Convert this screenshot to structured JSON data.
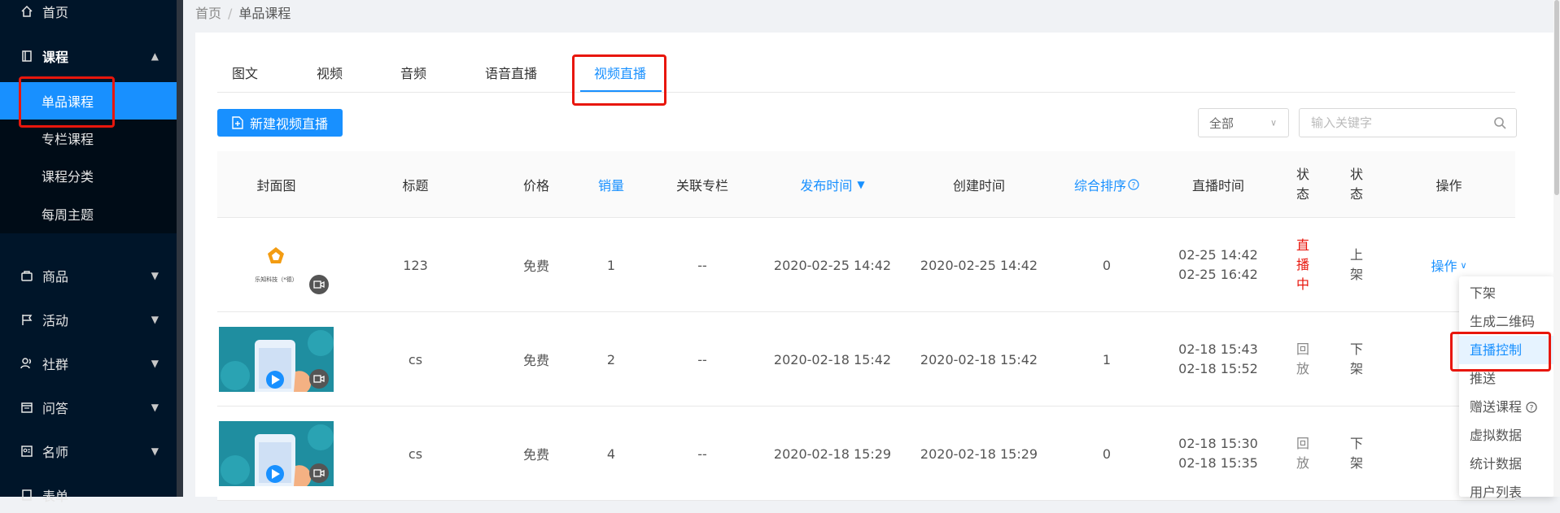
{
  "sidebar": {
    "items": [
      {
        "label": "首页",
        "icon": "home-icon"
      },
      {
        "label": "课程",
        "icon": "book-icon"
      },
      {
        "label": "商品",
        "icon": "bag-icon"
      },
      {
        "label": "活动",
        "icon": "flag-icon"
      },
      {
        "label": "社群",
        "icon": "users-icon"
      },
      {
        "label": "问答",
        "icon": "calendar-icon"
      },
      {
        "label": "名师",
        "icon": "id-card-icon"
      },
      {
        "label": "表单",
        "icon": "form-icon"
      }
    ],
    "course_submenu": [
      {
        "label": "单品课程",
        "active": true
      },
      {
        "label": "专栏课程",
        "active": false
      },
      {
        "label": "课程分类",
        "active": false
      },
      {
        "label": "每周主题",
        "active": false
      }
    ]
  },
  "breadcrumb": {
    "home": "首页",
    "separator": "/",
    "current": "单品课程"
  },
  "tabs": [
    {
      "label": "图文"
    },
    {
      "label": "视频"
    },
    {
      "label": "音频"
    },
    {
      "label": "语音直播"
    },
    {
      "label": "视频直播"
    }
  ],
  "toolbar": {
    "new_button_label": "新建视频直播",
    "filter_select_value": "全部",
    "search_placeholder": "输入关键字"
  },
  "table": {
    "columns": [
      "封面图",
      "标题",
      "价格",
      "销量",
      "关联专栏",
      "发布时间",
      "创建时间",
      "综合排序",
      "直播时间",
      "状\n态",
      "状\n态",
      "操作"
    ],
    "rows": [
      {
        "cover": "logo",
        "cover_text": "乐知科技（*德）",
        "title": "123",
        "price": "免费",
        "sales": "1",
        "column": "--",
        "publish_time": "2020-02-25 14:42",
        "create_time": "2020-02-25 14:42",
        "sort": "0",
        "live_start": "02-25 14:42",
        "live_end": "02-25 16:42",
        "status": [
          "直",
          "播",
          "中"
        ],
        "shelf": [
          "上",
          "架"
        ],
        "op": "操作"
      },
      {
        "cover": "video",
        "title": "cs",
        "price": "免费",
        "sales": "2",
        "column": "--",
        "publish_time": "2020-02-18 15:42",
        "create_time": "2020-02-18 15:42",
        "sort": "1",
        "live_start": "02-18 15:43",
        "live_end": "02-18 15:52",
        "status": [
          "回",
          "放"
        ],
        "shelf": [
          "下",
          "架"
        ],
        "op": ""
      },
      {
        "cover": "video",
        "title": "cs",
        "price": "免费",
        "sales": "4",
        "column": "--",
        "publish_time": "2020-02-18 15:29",
        "create_time": "2020-02-18 15:29",
        "sort": "0",
        "live_start": "02-18 15:30",
        "live_end": "02-18 15:35",
        "status": [
          "回",
          "放"
        ],
        "shelf": [
          "下",
          "架"
        ],
        "op": ""
      }
    ]
  },
  "dropdown": {
    "items": [
      "下架",
      "生成二维码",
      "直播控制",
      "推送",
      "赠送课程",
      "虚拟数据",
      "统计数据",
      "用户列表"
    ],
    "hovered": "直播控制"
  },
  "colors": {
    "primary": "#1890ff",
    "sidebar": "#001529",
    "live_red": "#e8160c",
    "highlight_red": "#e8160c"
  }
}
